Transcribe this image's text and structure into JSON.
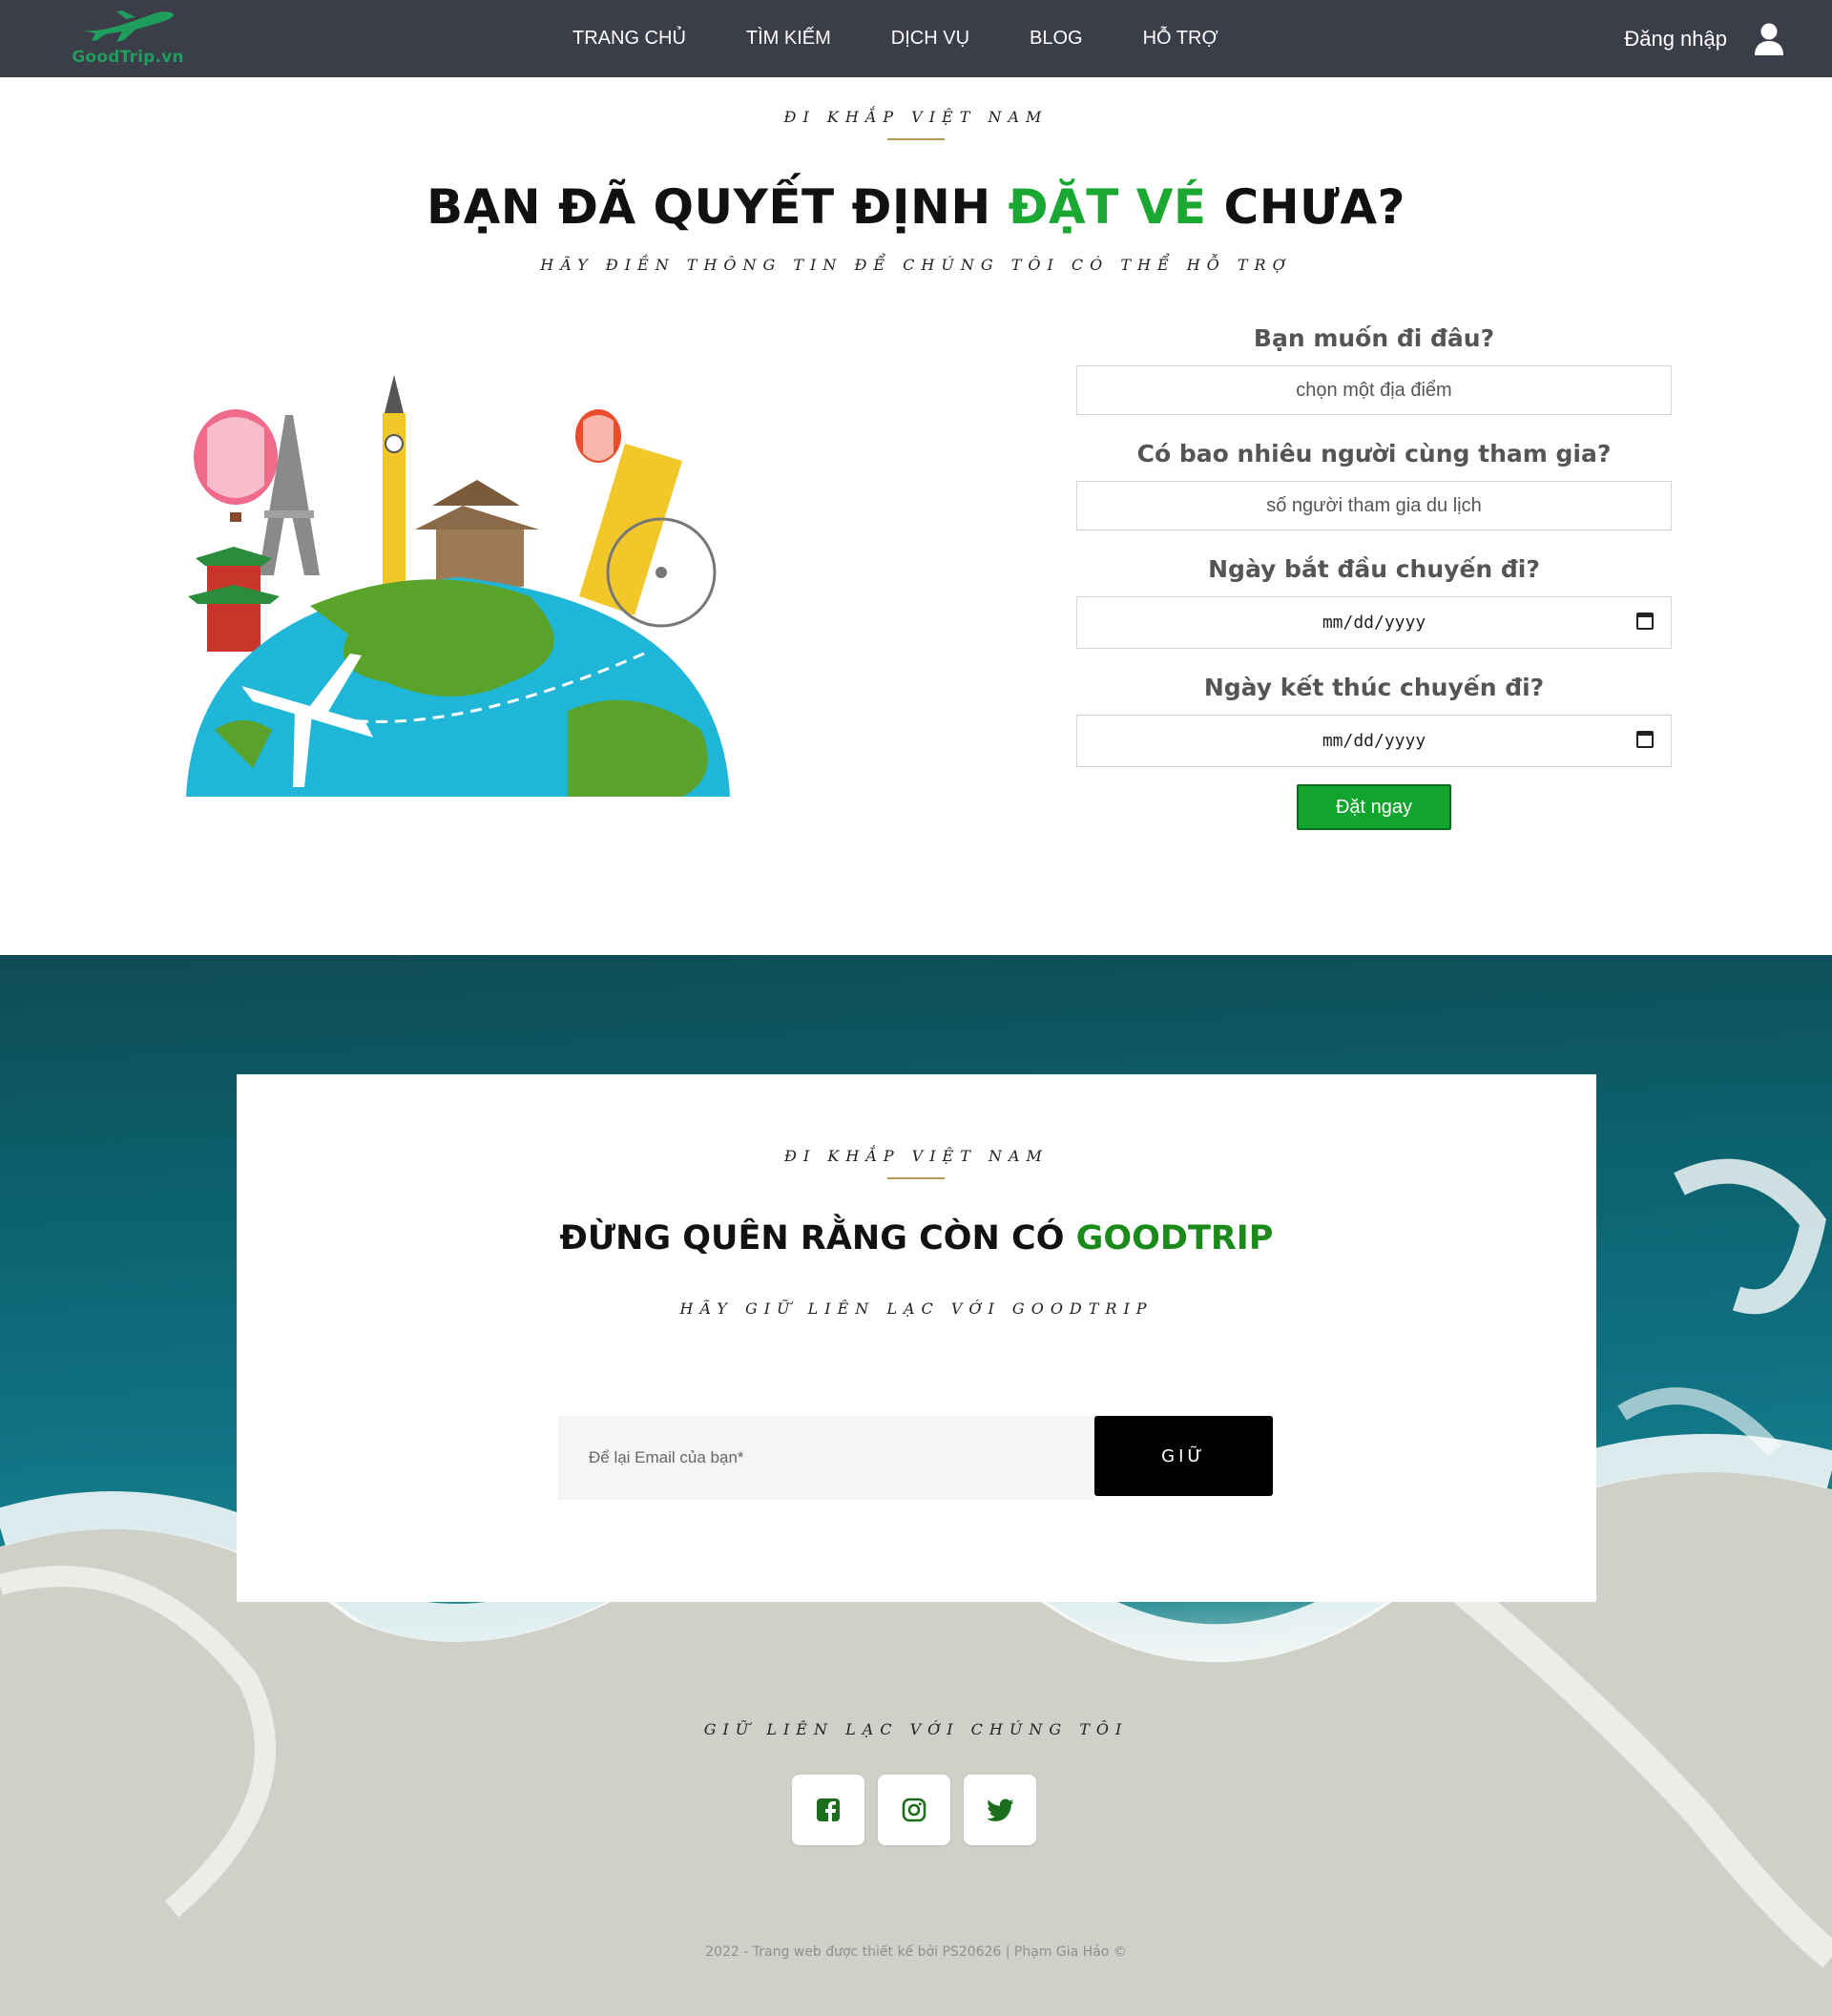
{
  "navbar": {
    "logo_text": "GoodTrip.vn",
    "links": [
      "TRANG CHỦ",
      "TÌM KIẾM",
      "DỊCH VỤ",
      "BLOG",
      "HỖ TRỢ"
    ],
    "login_label": "Đăng nhập"
  },
  "hero": {
    "eyebrow": "ĐI KHẮP VIỆT NAM",
    "title_part1": "BẠN ĐÃ QUYẾT ĐỊNH ",
    "title_highlight": "ĐẶT VÉ",
    "title_part2": " CHƯA?",
    "subtitle": "HÃY ĐIỀN THÔNG TIN ĐỂ CHÚNG TÔI CÓ THỂ HỖ TRỢ"
  },
  "form": {
    "destination_label": "Bạn muốn đi đâu?",
    "destination_placeholder": "chọn một địa điểm",
    "people_label": "Có bao nhiêu người cùng tham gia?",
    "people_placeholder": "số người tham gia du lịch",
    "start_label": "Ngày bắt đầu chuyến đi?",
    "start_value": "mm/dd/yyyy",
    "end_label": "Ngày kết thúc chuyến đi?",
    "end_value": "mm/dd/yyyy",
    "submit_label": "Đặt ngay"
  },
  "newsletter": {
    "eyebrow": "ĐI KHẮP VIỆT NAM",
    "title_part1": "ĐỪNG QUÊN RẰNG CÒN CÓ ",
    "title_highlight": "GOODTRIP",
    "subtitle": "HÃY GIỮ LIÊN LẠC VỚI GOODTRIP",
    "email_placeholder": "Để lại Email của bạn*",
    "submit_label": "GIỮ"
  },
  "footer": {
    "contact_label": "GIỮ LIÊN LẠC VỚI CHÚNG TÔI",
    "socials": [
      "facebook-icon",
      "instagram-icon",
      "twitter-icon"
    ],
    "copyright": "2022 - Trang web được thiết kế bởi PS20626 | Phạm Gia Hảo ©"
  },
  "colors": {
    "nav_bg": "#3b3d49",
    "brand_green": "#1aa833",
    "button_green": "#12a52d",
    "social_icon_green": "#1b6e1b"
  }
}
